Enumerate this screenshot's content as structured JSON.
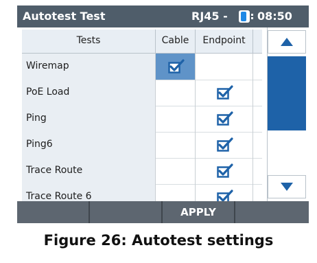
{
  "titlebar": {
    "title": "Autotest  Test",
    "port": "RJ45 -",
    "time": "08:50"
  },
  "table": {
    "headers": {
      "tests": "Tests",
      "cable": "Cable",
      "endpoint": "Endpoint"
    },
    "rows": [
      {
        "name": "Wiremap",
        "cable": true,
        "endpoint": false,
        "selected_cell": "cable"
      },
      {
        "name": "PoE Load",
        "cable": false,
        "endpoint": true
      },
      {
        "name": "Ping",
        "cable": false,
        "endpoint": true
      },
      {
        "name": "Ping6",
        "cable": false,
        "endpoint": true
      },
      {
        "name": "Trace Route",
        "cable": false,
        "endpoint": true
      },
      {
        "name": "Trace Route 6",
        "cable": false,
        "endpoint": true
      }
    ]
  },
  "softkeys": [
    "",
    "",
    "APPLY",
    ""
  ],
  "caption": "Figure 26: Autotest settings",
  "colors": {
    "titlebar": "#4f5d6a",
    "accent": "#1e62a8",
    "selected": "#5f93c8",
    "softbar": "#5d6670"
  }
}
